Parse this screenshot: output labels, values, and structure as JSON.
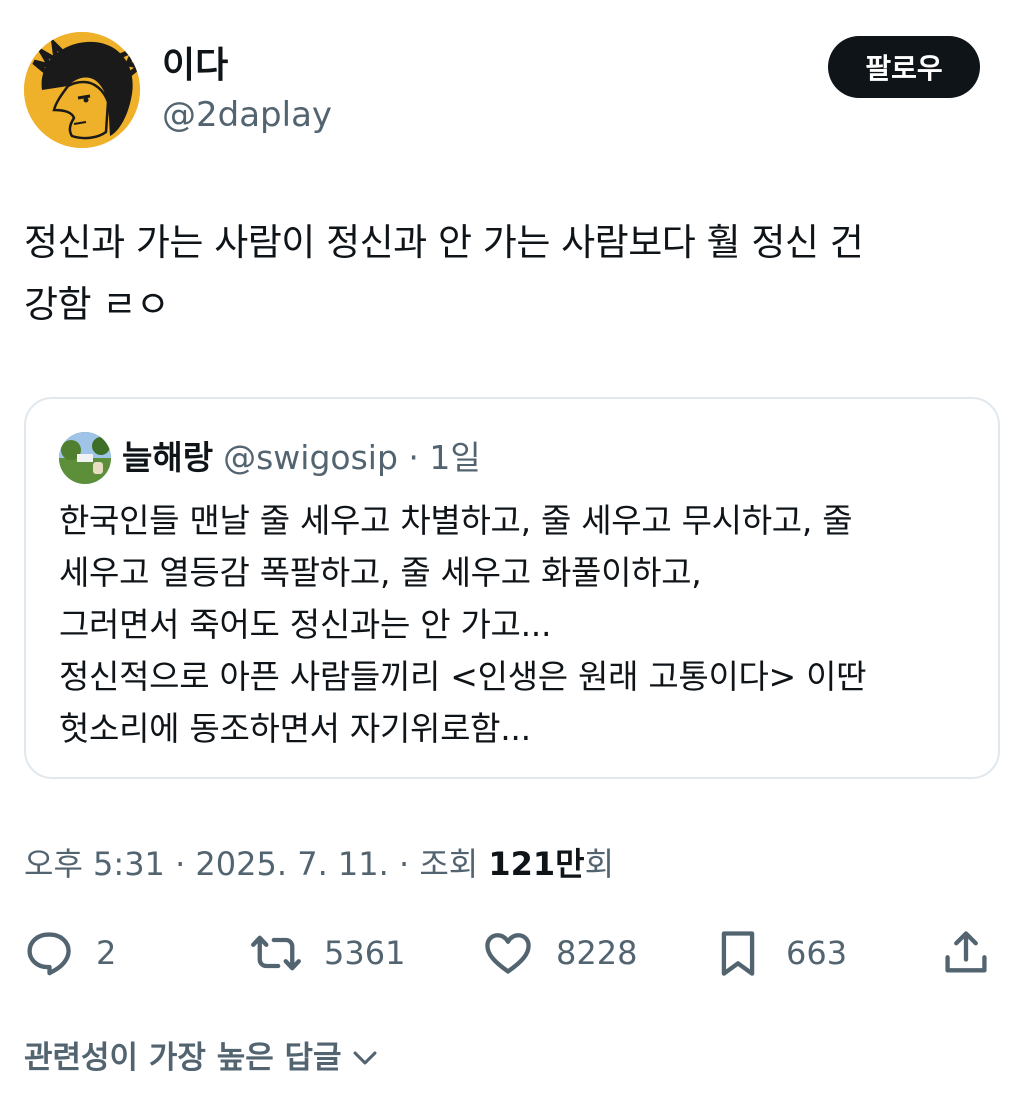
{
  "author": {
    "display_name": "이다",
    "handle": "@2daplay",
    "avatar_icon": "avatar-cartoon-face"
  },
  "follow_label": "팔로우",
  "tweet": {
    "line1": "정신과 가는 사람이 정신과 안 가는 사람보다 훨 정신 건",
    "line2": "강함 ㄹㅇ"
  },
  "quote": {
    "name": "늘해랑",
    "meta": "@swigosip · 1일",
    "lines": [
      "한국인들 맨날 줄 세우고 차별하고, 줄 세우고 무시하고, 줄",
      "세우고 열등감 폭팔하고, 줄 세우고 화풀이하고,",
      "그러면서 죽어도 정신과는 안 가고...",
      "정신적으로 아픈 사람들끼리 <인생은 원래 고통이다> 이딴",
      "헛소리에 동조하면서 자기위로함..."
    ]
  },
  "meta_line": {
    "prefix": "오후 5:31 · 2025. 7. 11. · 조회 ",
    "views_number": "121",
    "views_unit": "만",
    "suffix": "회"
  },
  "actions": {
    "replies": "2",
    "reposts": "5361",
    "likes": "8228",
    "bookmarks": "663"
  },
  "reply_sort_label": "관련성이 가장 높은 답글",
  "colors": {
    "text": "#0f1419",
    "secondary": "#536471",
    "border": "#e1e8ed",
    "follow_bg": "#0f1419",
    "avatar_bg": "#f0b12a"
  }
}
